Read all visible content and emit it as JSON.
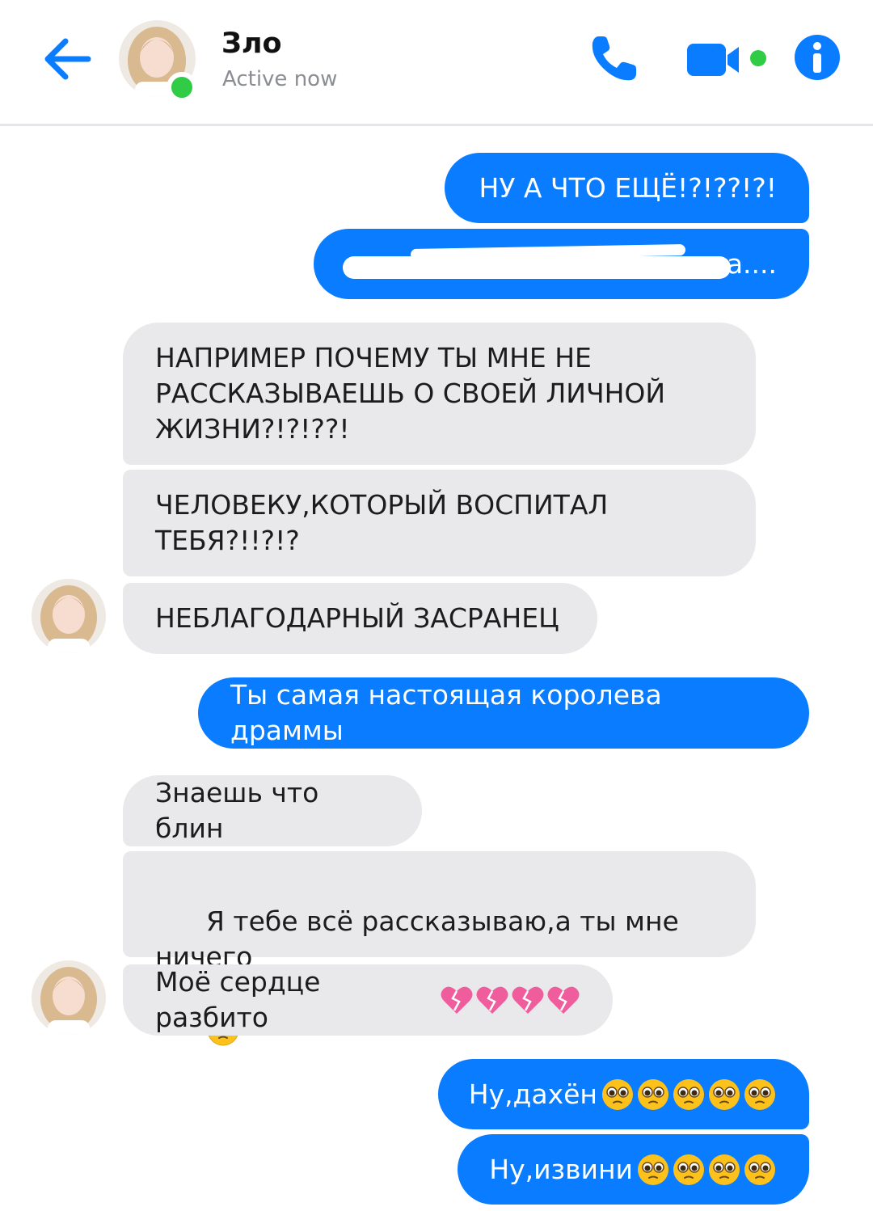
{
  "header": {
    "contact_name": "Зло",
    "status": "Active now",
    "online_color": "#31cc46",
    "back_icon": "arrow-left-icon",
    "call_icon": "phone-icon",
    "video_icon": "video-camera-icon",
    "info_icon": "info-icon"
  },
  "colors": {
    "accent": "#0a7cff",
    "incoming_bubble": "#e9e9eb"
  },
  "messages": [
    {
      "side": "out",
      "text": "НУ А ЧТО ЕЩЁ!?!??!?!"
    },
    {
      "side": "out",
      "text": "а....",
      "redacted": true
    },
    {
      "side": "in",
      "text": "НАПРИМЕР ПОЧЕМУ ТЫ МНЕ НЕ\nРАССКАЗЫВАЕШЬ О СВОЕЙ ЛИЧНОЙ\nЖИЗНИ?!?!??!"
    },
    {
      "side": "in",
      "text": "ЧЕЛОВЕКУ,КОТОРЫЙ ВОСПИТАЛ\nТЕБЯ?!!?!?"
    },
    {
      "side": "in",
      "text": "НЕБЛАГОДАРНЫЙ ЗАСРАНЕЦ"
    },
    {
      "side": "out",
      "text": "Ты самая настоящая королева драммы"
    },
    {
      "side": "in",
      "text": "Знаешь что блин"
    },
    {
      "side": "in",
      "text": "Я тебе всё рассказываю,а ты мне ничего"
    },
    {
      "side": "in",
      "text": "Моё сердце разбито"
    },
    {
      "side": "out",
      "text": "Ну,дахён"
    },
    {
      "side": "out",
      "text": "Ну,извини"
    }
  ]
}
